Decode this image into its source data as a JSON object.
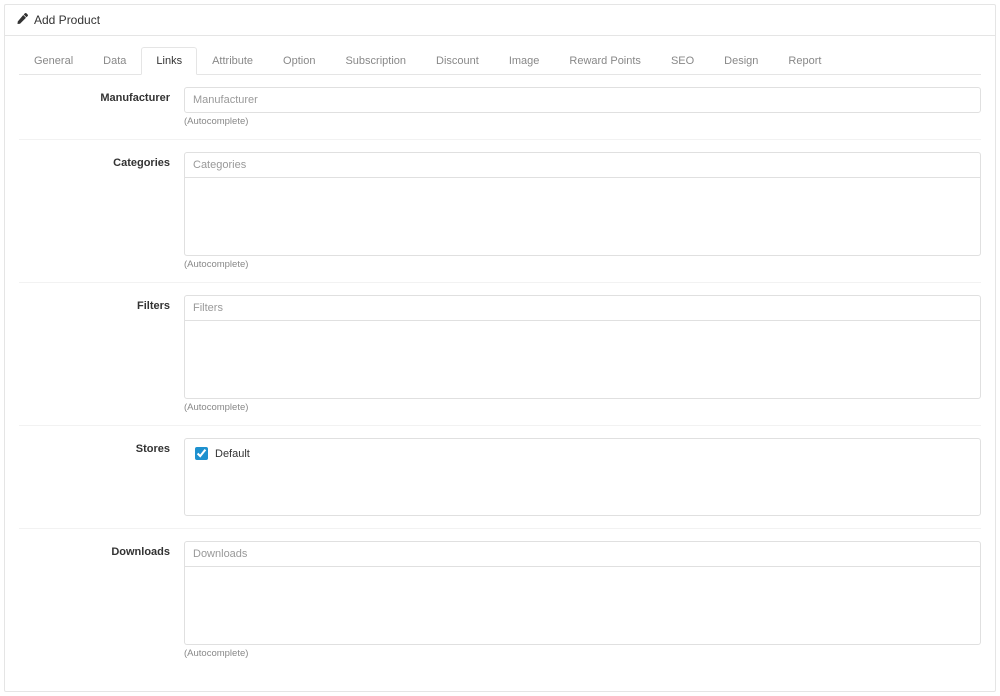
{
  "header": {
    "title": "Add Product"
  },
  "tabs": [
    {
      "id": "general",
      "label": "General"
    },
    {
      "id": "data",
      "label": "Data"
    },
    {
      "id": "links",
      "label": "Links",
      "active": true
    },
    {
      "id": "attribute",
      "label": "Attribute"
    },
    {
      "id": "option",
      "label": "Option"
    },
    {
      "id": "subscription",
      "label": "Subscription"
    },
    {
      "id": "discount",
      "label": "Discount"
    },
    {
      "id": "image",
      "label": "Image"
    },
    {
      "id": "reward",
      "label": "Reward Points"
    },
    {
      "id": "seo",
      "label": "SEO"
    },
    {
      "id": "design",
      "label": "Design"
    },
    {
      "id": "report",
      "label": "Report"
    }
  ],
  "fields": {
    "manufacturer": {
      "label": "Manufacturer",
      "placeholder": "Manufacturer",
      "helper": "(Autocomplete)"
    },
    "categories": {
      "label": "Categories",
      "placeholder": "Categories",
      "helper": "(Autocomplete)"
    },
    "filters": {
      "label": "Filters",
      "placeholder": "Filters",
      "helper": "(Autocomplete)"
    },
    "stores": {
      "label": "Stores",
      "options": [
        {
          "label": "Default",
          "checked": true
        }
      ]
    },
    "downloads": {
      "label": "Downloads",
      "placeholder": "Downloads",
      "helper": "(Autocomplete)"
    }
  }
}
